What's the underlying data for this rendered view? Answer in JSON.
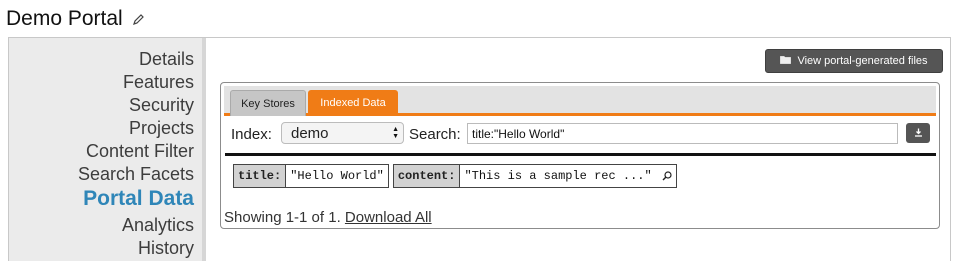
{
  "page": {
    "title": "Demo Portal",
    "edit_icon": "pencil-icon"
  },
  "sidebar": {
    "items": [
      {
        "label": "Details"
      },
      {
        "label": "Features"
      },
      {
        "label": "Security"
      },
      {
        "label": "Projects"
      },
      {
        "label": "Content Filter"
      },
      {
        "label": "Search Facets"
      },
      {
        "label": "Portal Data",
        "active": true
      },
      {
        "label": "Analytics"
      },
      {
        "label": "History"
      }
    ],
    "active_color": "#2f86b8"
  },
  "toolbar": {
    "view_files_label": "View portal-generated files",
    "view_files_icon": "folder-icon"
  },
  "tabs": [
    {
      "label": "Key Stores",
      "active": false
    },
    {
      "label": "Indexed Data",
      "active": true
    }
  ],
  "accent_color": "#f07c16",
  "search": {
    "index_label": "Index:",
    "index_value": "demo",
    "search_label": "Search:",
    "query": "title:\"Hello World\"",
    "download_icon": "download-icon"
  },
  "results": {
    "rows": [
      {
        "fields": [
          {
            "name": "title:",
            "value": "\"Hello World\""
          },
          {
            "name": "content:",
            "value": "\"This is a sample rec ...\""
          }
        ],
        "expand_icon": "search-icon"
      }
    ]
  },
  "status": {
    "showing_text": "Showing 1-1 of 1.",
    "download_all_label": "Download All"
  }
}
